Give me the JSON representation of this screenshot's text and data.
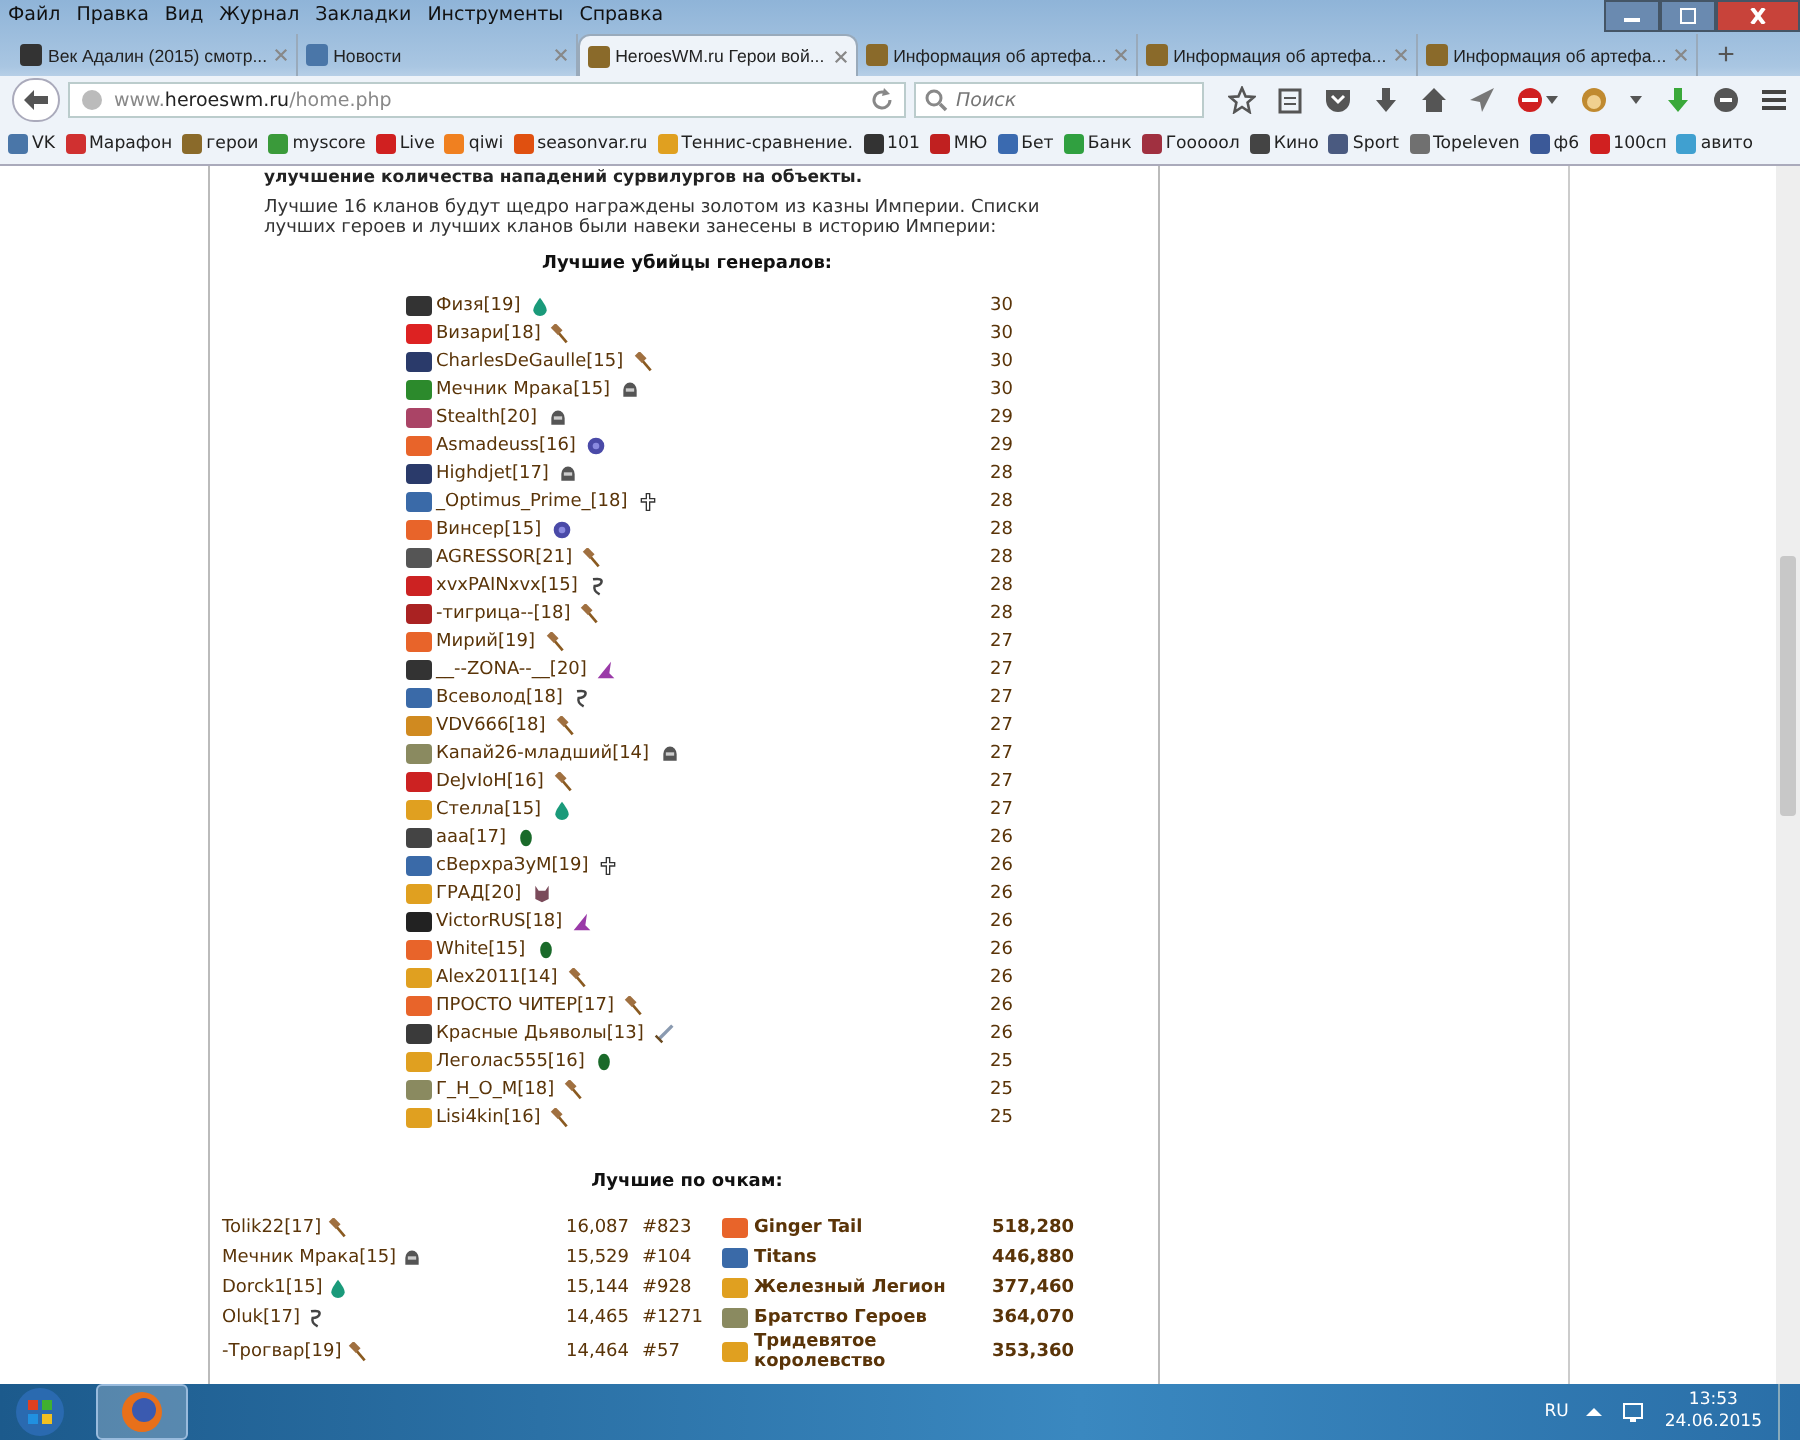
{
  "menu": [
    "Файл",
    "Правка",
    "Вид",
    "Журнал",
    "Закладки",
    "Инструменты",
    "Справка"
  ],
  "tabs": [
    {
      "title": "Век Адалин (2015) смотр...",
      "selected": false,
      "color": "#333333"
    },
    {
      "title": "Новости",
      "selected": false,
      "color": "#4a76a8"
    },
    {
      "title": "HeroesWM.ru Герои вой...",
      "selected": true,
      "color": "#8a6a2a"
    },
    {
      "title": "Информация об артефа...",
      "selected": false,
      "color": "#8a6a2a"
    },
    {
      "title": "Информация об артефа...",
      "selected": false,
      "color": "#8a6a2a"
    },
    {
      "title": "Информация об артефа...",
      "selected": false,
      "color": "#8a6a2a"
    }
  ],
  "new_tab": "+",
  "address": "www.**heroeswm.ru**/home.php",
  "search": {
    "placeholder": "Поиск"
  },
  "bookmarks": [
    {
      "label": "VK",
      "color": "#4a76a8"
    },
    {
      "label": "Марафон",
      "color": "#d03030"
    },
    {
      "label": "герои",
      "color": "#8a6a2a"
    },
    {
      "label": "myscore",
      "color": "#3a9a3a"
    },
    {
      "label": "Live",
      "color": "#d02020"
    },
    {
      "label": "qiwi",
      "color": "#f08020"
    },
    {
      "label": "seasonvar.ru",
      "color": "#e05010"
    },
    {
      "label": "Теннис-сравнение.",
      "color": "#e0a020"
    },
    {
      "label": "101",
      "color": "#333333"
    },
    {
      "label": "МЮ",
      "color": "#c02020"
    },
    {
      "label": "Бет",
      "color": "#3a6ab0"
    },
    {
      "label": "Банк",
      "color": "#30a040"
    },
    {
      "label": "Гооооол",
      "color": "#a03040"
    },
    {
      "label": "Кино",
      "color": "#444444"
    },
    {
      "label": "Sport",
      "color": "#4a5a80"
    },
    {
      "label": "Topeleven",
      "color": "#707070"
    },
    {
      "label": "ф6",
      "color": "#3b5998"
    },
    {
      "label": "100сп",
      "color": "#d02020"
    },
    {
      "label": "авито",
      "color": "#40a0d0"
    }
  ],
  "page": {
    "cut_line": "улучшение количества нападений сурвилургов на объекты.",
    "intro": "Лучшие 16 кланов будут щедро награждены золотом из казны Империи. Списки лучших героев и лучших кланов были навеки занесены в историю Империи:",
    "killers_title": "Лучшие убийцы генералов:",
    "killers": [
      {
        "name": "Физя[19]",
        "kind": "drop",
        "score": "30",
        "color": "#333333"
      },
      {
        "name": "Визари[18]",
        "kind": "hammer",
        "score": "30",
        "color": "#dd2222"
      },
      {
        "name": "CharlesDeGaulle[15]",
        "kind": "hammer",
        "score": "30",
        "color": "#2a3a6a"
      },
      {
        "name": "Мечник Мрака[15]",
        "kind": "skull",
        "score": "30",
        "color": "#2c8a2c"
      },
      {
        "name": "Stealth[20]",
        "kind": "skull",
        "score": "29",
        "color": "#aa4466"
      },
      {
        "name": "Asmadeuss[16]",
        "kind": "orb",
        "score": "29",
        "color": "#e8642a"
      },
      {
        "name": "Highdjet[17]",
        "kind": "skull",
        "score": "28",
        "color": "#2a3a6a"
      },
      {
        "name": "_Optimus_Prime_[18]",
        "kind": "cross",
        "score": "28",
        "color": "#3a6aa8"
      },
      {
        "name": "Винсер[15]",
        "kind": "orb",
        "score": "28",
        "color": "#e8642a"
      },
      {
        "name": "AGRESSOR[21]",
        "kind": "hammer",
        "score": "28",
        "color": "#555555"
      },
      {
        "name": "xvxPAINxvx[15]",
        "kind": "snake",
        "score": "28",
        "color": "#cc2222"
      },
      {
        "name": "-тигрица--[18]",
        "kind": "hammer",
        "score": "28",
        "color": "#aa2222"
      },
      {
        "name": "Мирий[19]",
        "kind": "hammer",
        "score": "27",
        "color": "#e8642a"
      },
      {
        "name": "__--ZONA--__[20]",
        "kind": "hat",
        "score": "27",
        "color": "#333333"
      },
      {
        "name": "Всеволод[18]",
        "kind": "snake",
        "score": "27",
        "color": "#3a6aa8"
      },
      {
        "name": "VDV666[18]",
        "kind": "hammer",
        "score": "27",
        "color": "#d08a20"
      },
      {
        "name": "Капай26-младший[14]",
        "kind": "skull",
        "score": "27",
        "color": "#8a8a60"
      },
      {
        "name": "DeJvIoH[16]",
        "kind": "hammer",
        "score": "27",
        "color": "#cc2222"
      },
      {
        "name": "Стелла[15]",
        "kind": "drop",
        "score": "27",
        "color": "#e0a020"
      },
      {
        "name": "aaa[17]",
        "kind": "leaf",
        "score": "26",
        "color": "#444444"
      },
      {
        "name": "сВерхраЗуМ[19]",
        "kind": "cross",
        "score": "26",
        "color": "#3a6aa8"
      },
      {
        "name": "ГРАД[20]",
        "kind": "demon",
        "score": "26",
        "color": "#e0a020"
      },
      {
        "name": "VictorRUS[18]",
        "kind": "hat",
        "score": "26",
        "color": "#222222"
      },
      {
        "name": "White[15]",
        "kind": "leaf",
        "score": "26",
        "color": "#e8642a"
      },
      {
        "name": "Alex2011[14]",
        "kind": "hammer",
        "score": "26",
        "color": "#e0a020"
      },
      {
        "name": "ПРОСТО ЧИТЕР[17]",
        "kind": "hammer",
        "score": "26",
        "color": "#e8642a"
      },
      {
        "name": "Красные Дьяволы[13]",
        "kind": "sword",
        "score": "26",
        "color": "#3a3a3a"
      },
      {
        "name": "Леголас555[16]",
        "kind": "leaf",
        "score": "25",
        "color": "#e0a020"
      },
      {
        "name": "Г_Н_О_М[18]",
        "kind": "hammer",
        "score": "25",
        "color": "#8a8a60"
      },
      {
        "name": "Lisi4kin[16]",
        "kind": "hammer",
        "score": "25",
        "color": "#e0a020"
      }
    ],
    "points_title": "Лучшие по очкам:",
    "points": [
      {
        "name": "Tolik22[17]",
        "kind": "hammer",
        "score": "16,087",
        "rank": "#823",
        "clan": "Ginger Tail",
        "clan_points": "518,280",
        "color": "#e8642a"
      },
      {
        "name": "Мечник Мрака[15]",
        "kind": "skull",
        "score": "15,529",
        "rank": "#104",
        "clan": "Titans",
        "clan_points": "446,880",
        "color": "#3a6aa8"
      },
      {
        "name": "Dorck1[15]",
        "kind": "drop",
        "score": "15,144",
        "rank": "#928",
        "clan": "Железный Легион",
        "clan_points": "377,460",
        "color": "#e0a020"
      },
      {
        "name": "Oluk[17]",
        "kind": "snake",
        "score": "14,465",
        "rank": "#1271",
        "clan": "Братство Героев",
        "clan_points": "364,070",
        "color": "#8a8a60"
      },
      {
        "name": "-Трогвар[19]",
        "kind": "hammer",
        "score": "14,464",
        "rank": "#57",
        "clan": "Тридевятое королевство",
        "clan_points": "353,360",
        "color": "#e0a020"
      }
    ]
  },
  "taskbar": {
    "language": "RU",
    "time": "13:53",
    "date": "24.06.2015"
  }
}
